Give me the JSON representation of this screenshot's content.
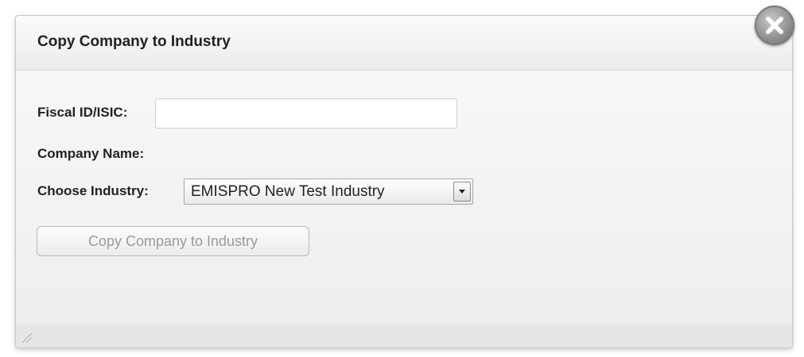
{
  "dialog": {
    "title": "Copy Company to Industry"
  },
  "form": {
    "fiscal_label": "Fiscal ID/ISIC:",
    "fiscal_value": "",
    "company_label": "Company Name:",
    "industry_label": "Choose Industry:",
    "industry_selected": "EMISPRO New Test Industry",
    "submit_label": "Copy Company to Industry"
  },
  "icons": {
    "close": "close-icon",
    "dropdown": "chevron-down-icon",
    "resize": "resize-grip-icon"
  }
}
